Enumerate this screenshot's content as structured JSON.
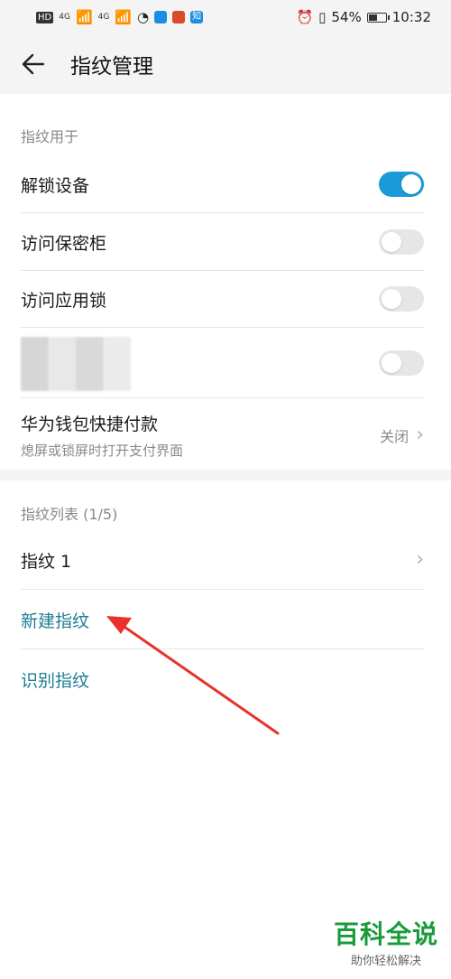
{
  "status": {
    "network_badge": "HD",
    "net_a": "4G",
    "net_b": "4G",
    "app1_color": "#1a8ee0",
    "app2_color": "#d94a2b",
    "app3_label": "知",
    "battery_percent": "54%",
    "battery_level": 0.54,
    "time": "10:32"
  },
  "header": {
    "title": "指纹管理"
  },
  "usage": {
    "section_label": "指纹用于",
    "items": [
      {
        "label": "解锁设备",
        "enabled": true
      },
      {
        "label": "访问保密柜",
        "enabled": false
      },
      {
        "label": "访问应用锁",
        "enabled": false
      },
      {
        "label": "",
        "enabled": false
      }
    ],
    "wallet": {
      "label": "华为钱包快捷付款",
      "subtitle": "熄屏或锁屏时打开支付界面",
      "value": "关闭"
    }
  },
  "list": {
    "section_label": "指纹列表 (1/5)",
    "fingerprint_item": "指纹 1",
    "new_action": "新建指纹",
    "identify_action": "识别指纹"
  },
  "watermark": {
    "title": "百科全说",
    "subtitle": "助你轻松解决"
  },
  "colors": {
    "accent": "#1a9bd7",
    "link": "#1f7c93",
    "annotation_arrow": "#e8322b"
  }
}
